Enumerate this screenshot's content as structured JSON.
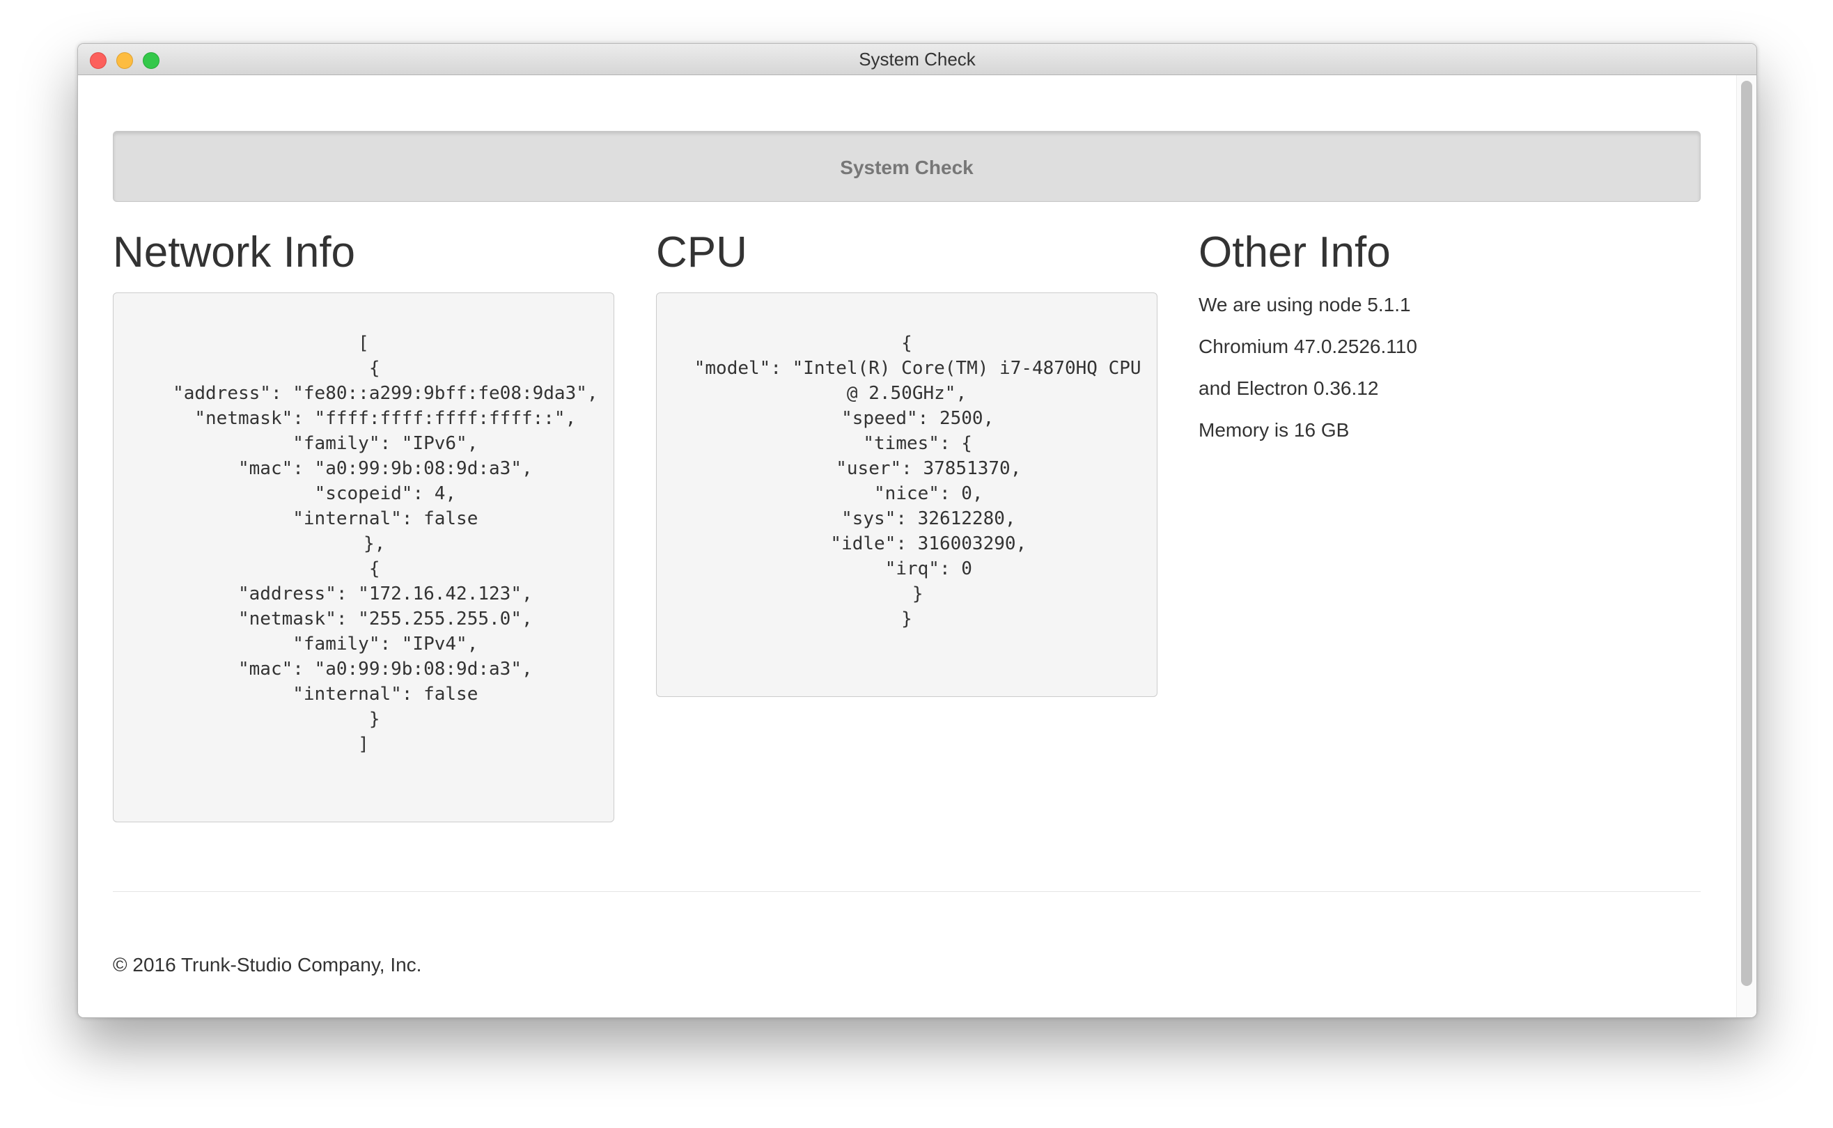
{
  "window": {
    "title": "System Check"
  },
  "main": {
    "check_button_label": "System Check",
    "network": {
      "heading": "Network Info",
      "json": "[\n  {\n    \"address\": \"fe80::a299:9bff:fe08:9da3\",\n    \"netmask\": \"ffff:ffff:ffff:ffff::\",\n    \"family\": \"IPv6\",\n    \"mac\": \"a0:99:9b:08:9d:a3\",\n    \"scopeid\": 4,\n    \"internal\": false\n  },\n  {\n    \"address\": \"172.16.42.123\",\n    \"netmask\": \"255.255.255.0\",\n    \"family\": \"IPv4\",\n    \"mac\": \"a0:99:9b:08:9d:a3\",\n    \"internal\": false\n  }\n]"
    },
    "cpu": {
      "heading": "CPU",
      "json": "{\n  \"model\": \"Intel(R) Core(TM) i7-4870HQ CPU @ 2.50GHz\",\n  \"speed\": 2500,\n  \"times\": {\n    \"user\": 37851370,\n    \"nice\": 0,\n    \"sys\": 32612280,\n    \"idle\": 316003290,\n    \"irq\": 0\n  }\n}"
    },
    "other": {
      "heading": "Other Info",
      "lines": [
        "We are using node 5.1.1",
        "Chromium 47.0.2526.110",
        "and Electron 0.36.12",
        "Memory is 16 GB"
      ]
    }
  },
  "footer": {
    "copyright": "© 2016 Trunk-Studio Company, Inc."
  },
  "colors": {
    "close": "#fc605c",
    "minimize": "#fdbc40",
    "maximize": "#34c84a",
    "button_bg": "#dedede",
    "code_bg": "#f5f5f5"
  }
}
